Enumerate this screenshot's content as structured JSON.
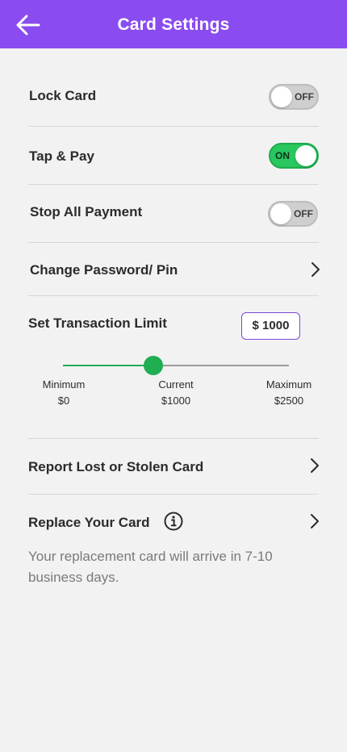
{
  "header": {
    "title": "Card Settings",
    "background": "#8a4cf0"
  },
  "settings": {
    "lock_card": {
      "label": "Lock Card",
      "state": "OFF"
    },
    "tap_pay": {
      "label": "Tap & Pay",
      "state": "ON"
    },
    "stop_payment": {
      "label": "Stop All Payment",
      "state": "OFF"
    },
    "change_password": {
      "label": "Change Password/ Pin"
    }
  },
  "limit": {
    "label": "Set Transaction Limit",
    "input_value": "$ 1000",
    "current_fraction": 0.4,
    "minimum": {
      "label": "Minimum",
      "value": "$0"
    },
    "current": {
      "label": "Current",
      "value": "$1000"
    },
    "maximum": {
      "label": "Maximum",
      "value": "$2500"
    },
    "accent": "#1fae52"
  },
  "report": {
    "label": "Report Lost or Stolen Card"
  },
  "replace": {
    "label": "Replace Your Card",
    "note": "Your replacement card will arrive in 7-10 business days."
  },
  "icons": [
    "arrow-left-icon",
    "chevron-right-icon",
    "info-icon"
  ]
}
